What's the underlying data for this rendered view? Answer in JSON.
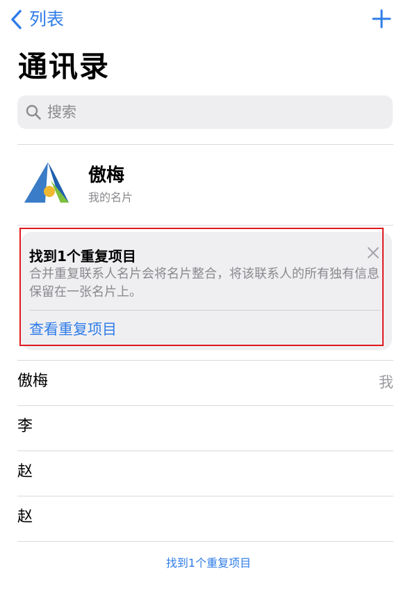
{
  "nav": {
    "back_label": "列表",
    "back_icon": "chevron-left-icon",
    "add_icon": "plus-icon"
  },
  "page_title": "通讯录",
  "search": {
    "placeholder": "搜索",
    "icon": "search-icon"
  },
  "my_card": {
    "name": "傲梅",
    "subtitle": "我的名片"
  },
  "duplicate_card": {
    "title": "找到1个重复项目",
    "description": "合并重复联系人名片会将名片整合，将该联系人的所有独有信息保留在一张名片上。",
    "link": "查看重复项目",
    "close_icon": "close-icon"
  },
  "contacts": [
    {
      "name": "傲梅",
      "badge": "我"
    },
    {
      "name": "李",
      "badge": ""
    },
    {
      "name": "赵",
      "badge": ""
    },
    {
      "name": "赵",
      "badge": ""
    }
  ],
  "footer_link": "找到1个重复项目",
  "colors": {
    "accent": "#2f7ce8",
    "highlight": "#e1191e",
    "card_bg": "#efeff2"
  }
}
